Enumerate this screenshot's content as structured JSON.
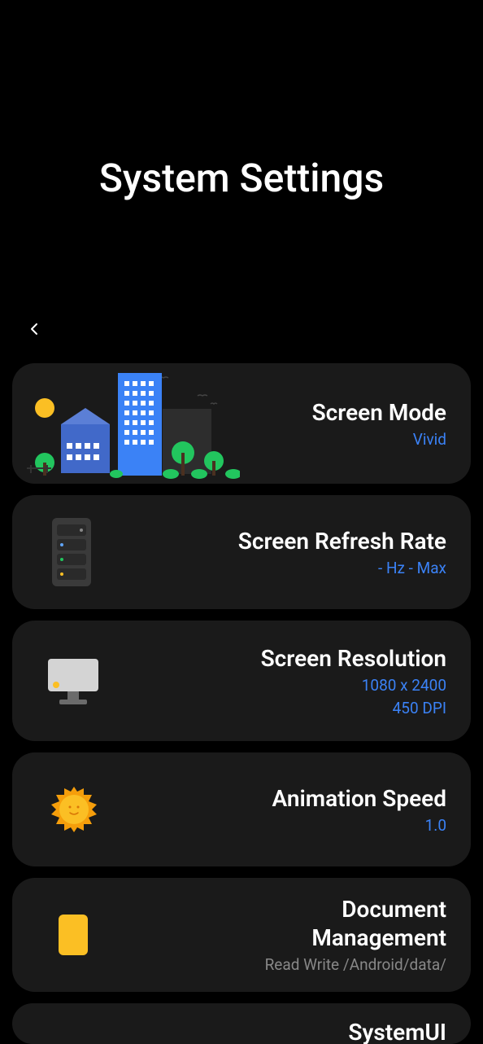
{
  "header": {
    "title": "System Settings"
  },
  "cards": {
    "screenMode": {
      "title": "Screen Mode",
      "value": "Vivid"
    },
    "refreshRate": {
      "title": "Screen Refresh Rate",
      "value": "- Hz - Max"
    },
    "resolution": {
      "title": "Screen Resolution",
      "value1": "1080 x 2400",
      "value2": "450 DPI"
    },
    "animation": {
      "title": "Animation Speed",
      "value": "1.0"
    },
    "document": {
      "title1": "Document",
      "title2": "Management",
      "subtitle": "Read Write /Android/data/"
    },
    "systemui": {
      "title": "SystemUI"
    }
  }
}
